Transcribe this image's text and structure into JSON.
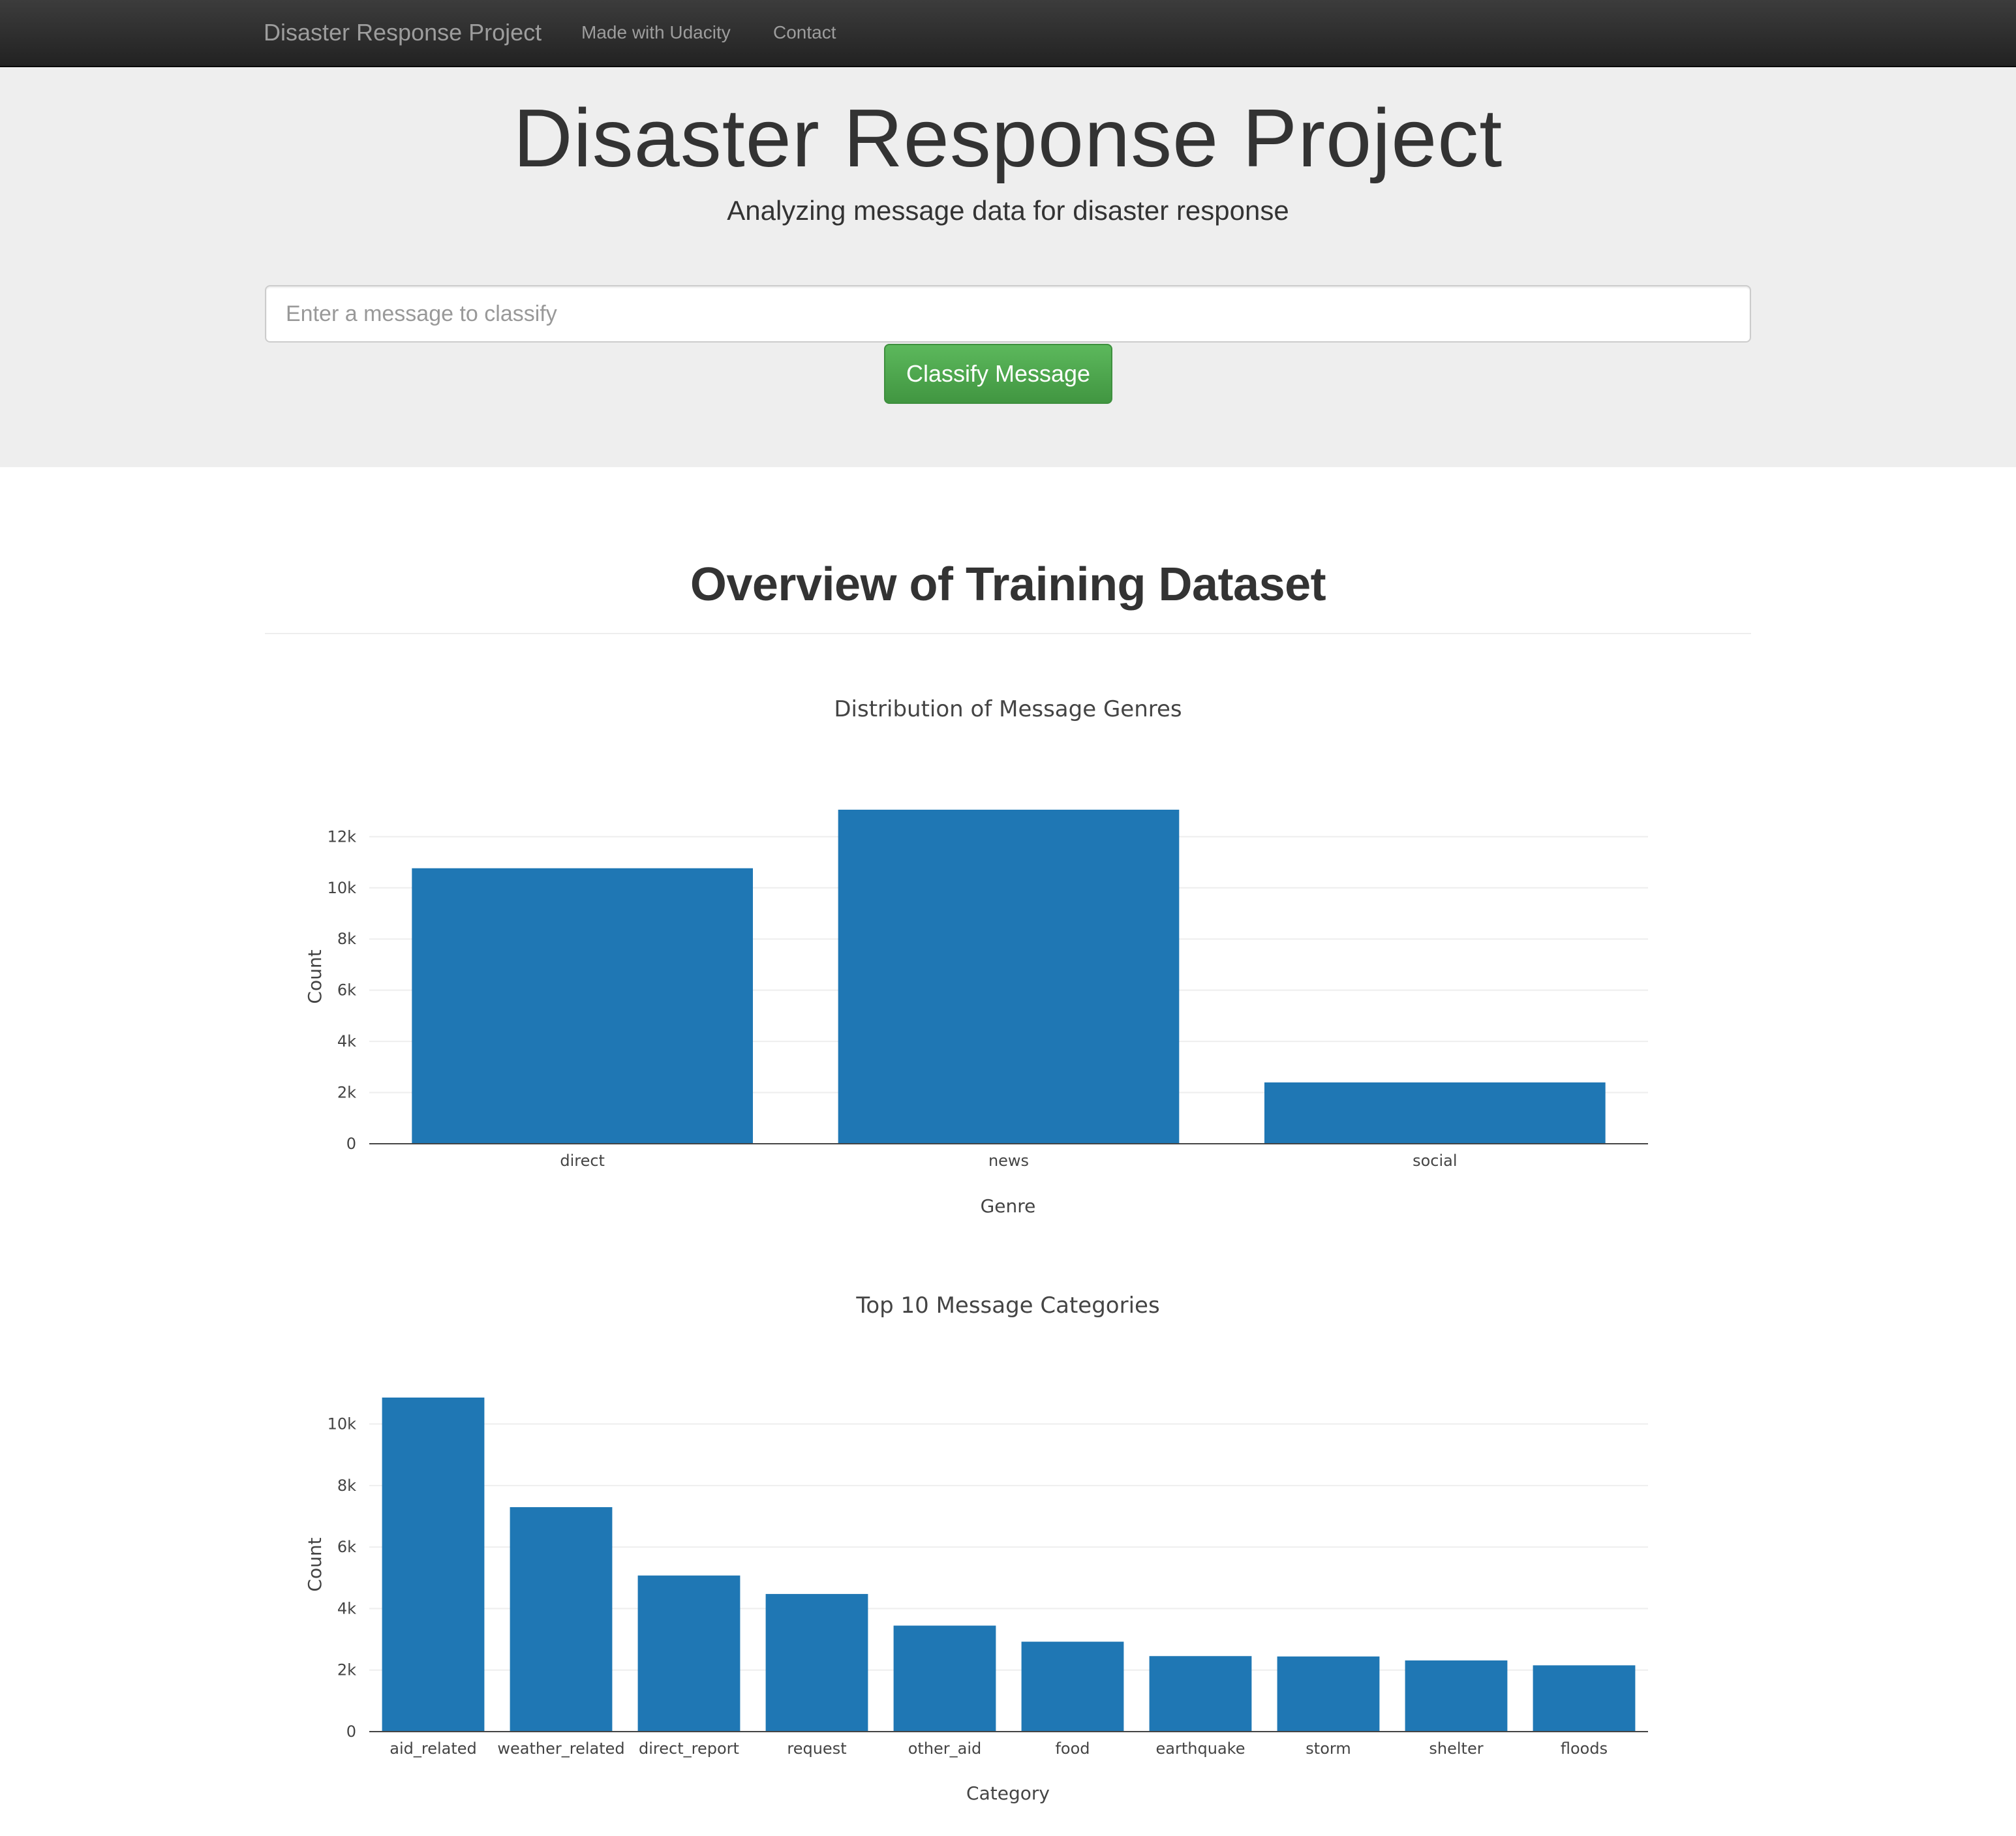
{
  "navbar": {
    "brand": "Disaster Response Project",
    "links": [
      "Made with Udacity",
      "Contact"
    ]
  },
  "jumbotron": {
    "title": "Disaster Response Project",
    "subtitle": "Analyzing message data for disaster response",
    "input_placeholder": "Enter a message to classify",
    "button_label": "Classify Message"
  },
  "section": {
    "title": "Overview of Training Dataset"
  },
  "colors": {
    "bar": "#1f77b4",
    "button": "#5cb85c",
    "navbar": "#222222"
  },
  "chart_data": [
    {
      "type": "bar",
      "title": "Distribution of Message Genres",
      "categories": [
        "direct",
        "news",
        "social"
      ],
      "values": [
        10766,
        13054,
        2396
      ],
      "xlabel": "Genre",
      "ylabel": "Count",
      "ylim": [
        0,
        13054
      ],
      "yticks": [
        0,
        2000,
        4000,
        6000,
        8000,
        10000,
        12000
      ],
      "ytick_labels": [
        "0",
        "2k",
        "4k",
        "6k",
        "8k",
        "10k",
        "12k"
      ],
      "grid": true
    },
    {
      "type": "bar",
      "title": "Top 10 Message Categories",
      "categories": [
        "aid_related",
        "weather_related",
        "direct_report",
        "request",
        "other_aid",
        "food",
        "earthquake",
        "storm",
        "shelter",
        "floods"
      ],
      "values": [
        10860,
        7297,
        5075,
        4474,
        3446,
        2923,
        2455,
        2443,
        2314,
        2155
      ],
      "xlabel": "Category",
      "ylabel": "Count",
      "ylim": [
        0,
        10860
      ],
      "yticks": [
        0,
        2000,
        4000,
        6000,
        8000,
        10000
      ],
      "ytick_labels": [
        "0",
        "2k",
        "4k",
        "6k",
        "8k",
        "10k"
      ],
      "grid": true
    }
  ]
}
